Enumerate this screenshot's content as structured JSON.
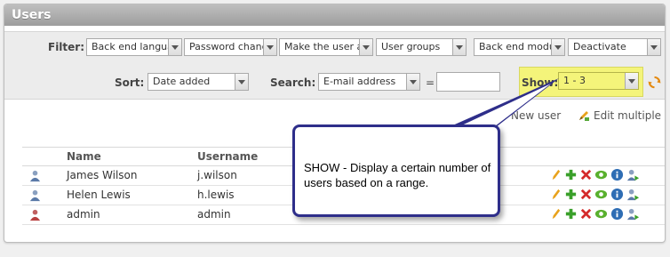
{
  "panel": {
    "title": "Users"
  },
  "filter": {
    "label": "Filter:",
    "selects": [
      "Back end langua",
      "Password chang",
      "Make the user a",
      "User groups",
      "Back end module",
      "Deactivate"
    ]
  },
  "sort": {
    "label": "Sort:",
    "value": "Date added"
  },
  "search": {
    "label": "Search:",
    "field": "E-mail address",
    "operator": "=",
    "value": ""
  },
  "show": {
    "label": "Show:",
    "value": "1 - 3"
  },
  "actions": {
    "new_user": "New user",
    "edit_multiple": "Edit multiple"
  },
  "table": {
    "columns": [
      "Name",
      "Username"
    ],
    "rows": [
      {
        "name": "James Wilson",
        "username": "j.wilson",
        "status": "active"
      },
      {
        "name": "Helen Lewis",
        "username": "h.lewis",
        "status": "active"
      },
      {
        "name": "admin",
        "username": "admin",
        "status": "admin"
      }
    ]
  },
  "callout": {
    "text": "SHOW - Display a certain number of users based on a range."
  },
  "colors": {
    "header_gray": "#9d9d9d",
    "highlight_yellow": "#f4f47a",
    "callout_border": "#2e2e8a",
    "edit_orange": "#e8a21c",
    "add_green": "#3aa02a",
    "delete_red": "#d42a2a",
    "view_green": "#5ab02e",
    "info_blue": "#2e6db4"
  },
  "icons": [
    "user-icon",
    "edit-icon",
    "copy-plus-icon",
    "delete-icon",
    "eye-icon",
    "info-icon",
    "toggle-user-icon",
    "refresh-icon",
    "add-icon",
    "edit-multiple-icon"
  ]
}
